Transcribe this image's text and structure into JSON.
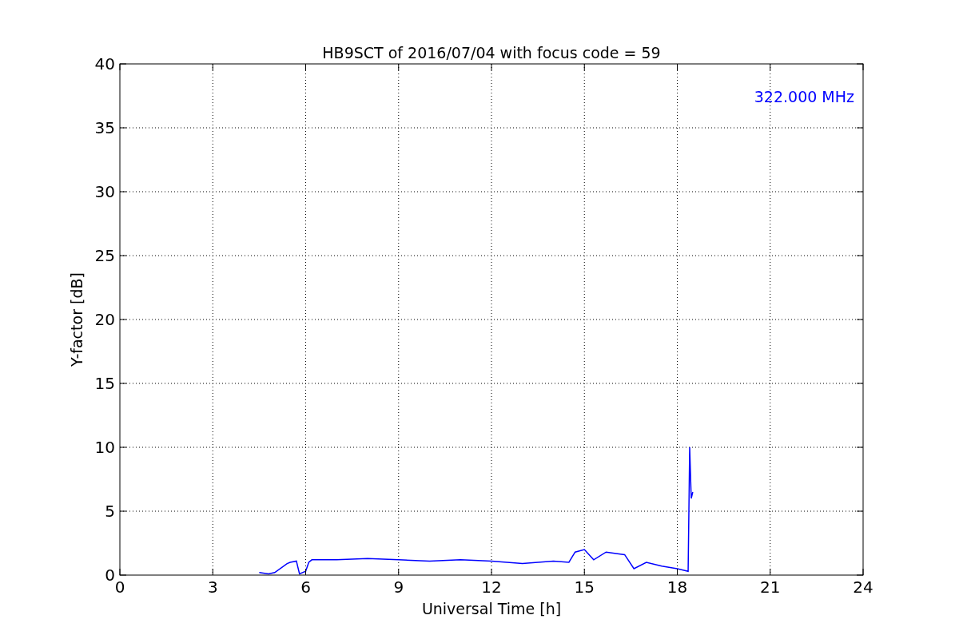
{
  "chart_data": {
    "type": "line",
    "title": "HB9SCT of 2016/07/04 with focus code = 59",
    "xlabel": "Universal Time [h]",
    "ylabel": "Y-factor [dB]",
    "x": [
      4.5,
      4.8,
      5.0,
      5.4,
      5.5,
      5.7,
      5.8,
      6.0,
      6.1,
      6.2,
      7,
      8,
      9,
      10,
      11,
      12,
      13,
      14,
      14.5,
      14.7,
      15,
      15.3,
      15.7,
      16.3,
      16.6,
      17,
      17.5,
      18,
      18.35,
      18.4,
      18.45,
      18.5
    ],
    "series": [
      {
        "color": "#0000ff",
        "values": [
          0.2,
          0.1,
          0.2,
          0.9,
          1.0,
          1.1,
          0.1,
          0.3,
          1.0,
          1.2,
          1.2,
          1.3,
          1.2,
          1.1,
          1.2,
          1.1,
          0.9,
          1.1,
          1.0,
          1.8,
          2.0,
          1.2,
          1.8,
          1.6,
          0.5,
          1.0,
          0.7,
          0.5,
          0.3,
          10,
          6,
          6.5
        ]
      }
    ],
    "xlim": [
      0,
      24
    ],
    "ylim": [
      0,
      40
    ],
    "xticks": [
      0,
      3,
      6,
      9,
      12,
      15,
      18,
      21,
      24
    ],
    "yticks": [
      0,
      5,
      10,
      15,
      20,
      25,
      30,
      35,
      40
    ],
    "grid": true,
    "annotations": [
      "322.000 MHz"
    ]
  }
}
